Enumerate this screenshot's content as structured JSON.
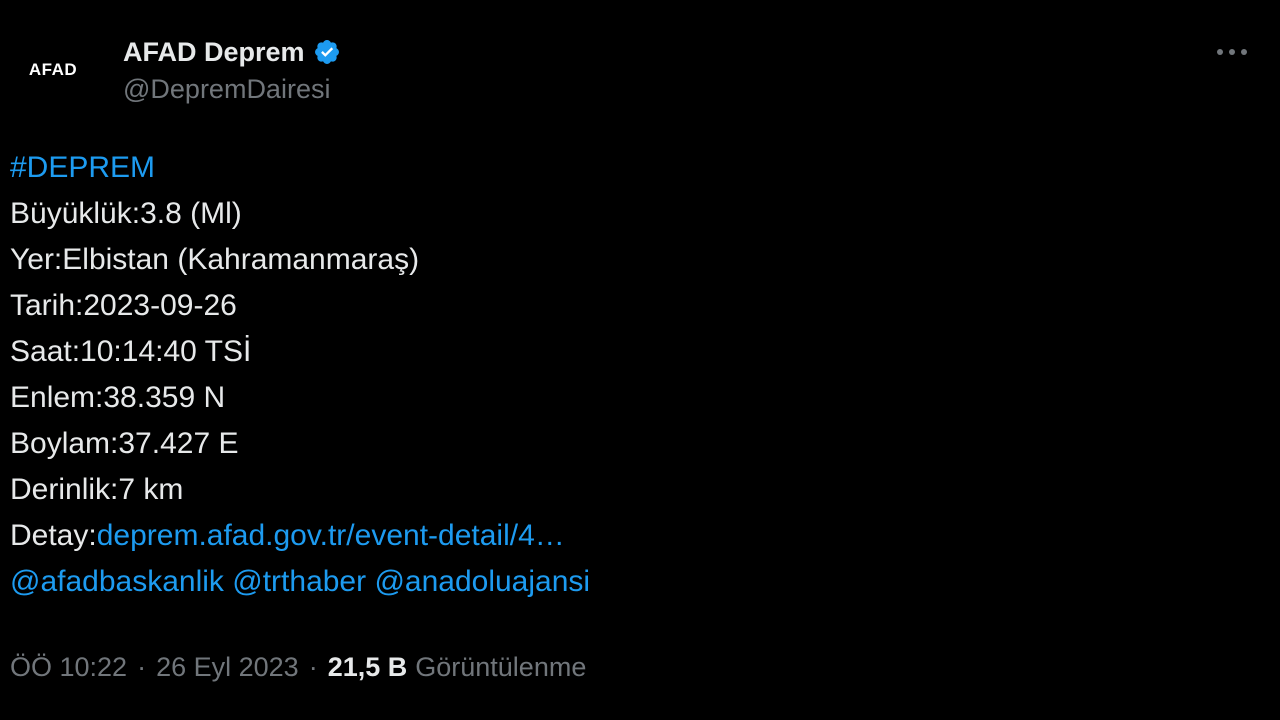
{
  "author": {
    "avatar_text": "AFAD",
    "display_name": "AFAD Deprem",
    "handle": "@DepremDairesi",
    "verified_color": "#1d9bf0"
  },
  "post": {
    "hashtag": "#DEPREM",
    "lines": [
      "Büyüklük:3.8 (Ml)",
      "Yer:Elbistan (Kahramanmaraş)",
      "Tarih:2023-09-26",
      "Saat:10:14:40 TSİ",
      "Enlem:38.359 N",
      "Boylam:37.427 E",
      "Derinlik:7 km"
    ],
    "detail_label": "Detay:",
    "detail_link": "deprem.afad.gov.tr/event-detail/4…",
    "mentions": [
      "@afadbaskanlik",
      "@trthaber",
      "@anadoluajansi"
    ]
  },
  "meta": {
    "time": "ÖÖ 10:22",
    "date": "26 Eyl 2023",
    "separator": "·",
    "views_count": "21,5 B",
    "views_label": "Görüntülenme"
  },
  "colors": {
    "background": "#000000",
    "text": "#e7e9ea",
    "secondary": "#71767b",
    "link": "#1d9bf0"
  },
  "icons": {
    "more": "more-horizontal-icon",
    "verified": "verified-badge-icon"
  }
}
